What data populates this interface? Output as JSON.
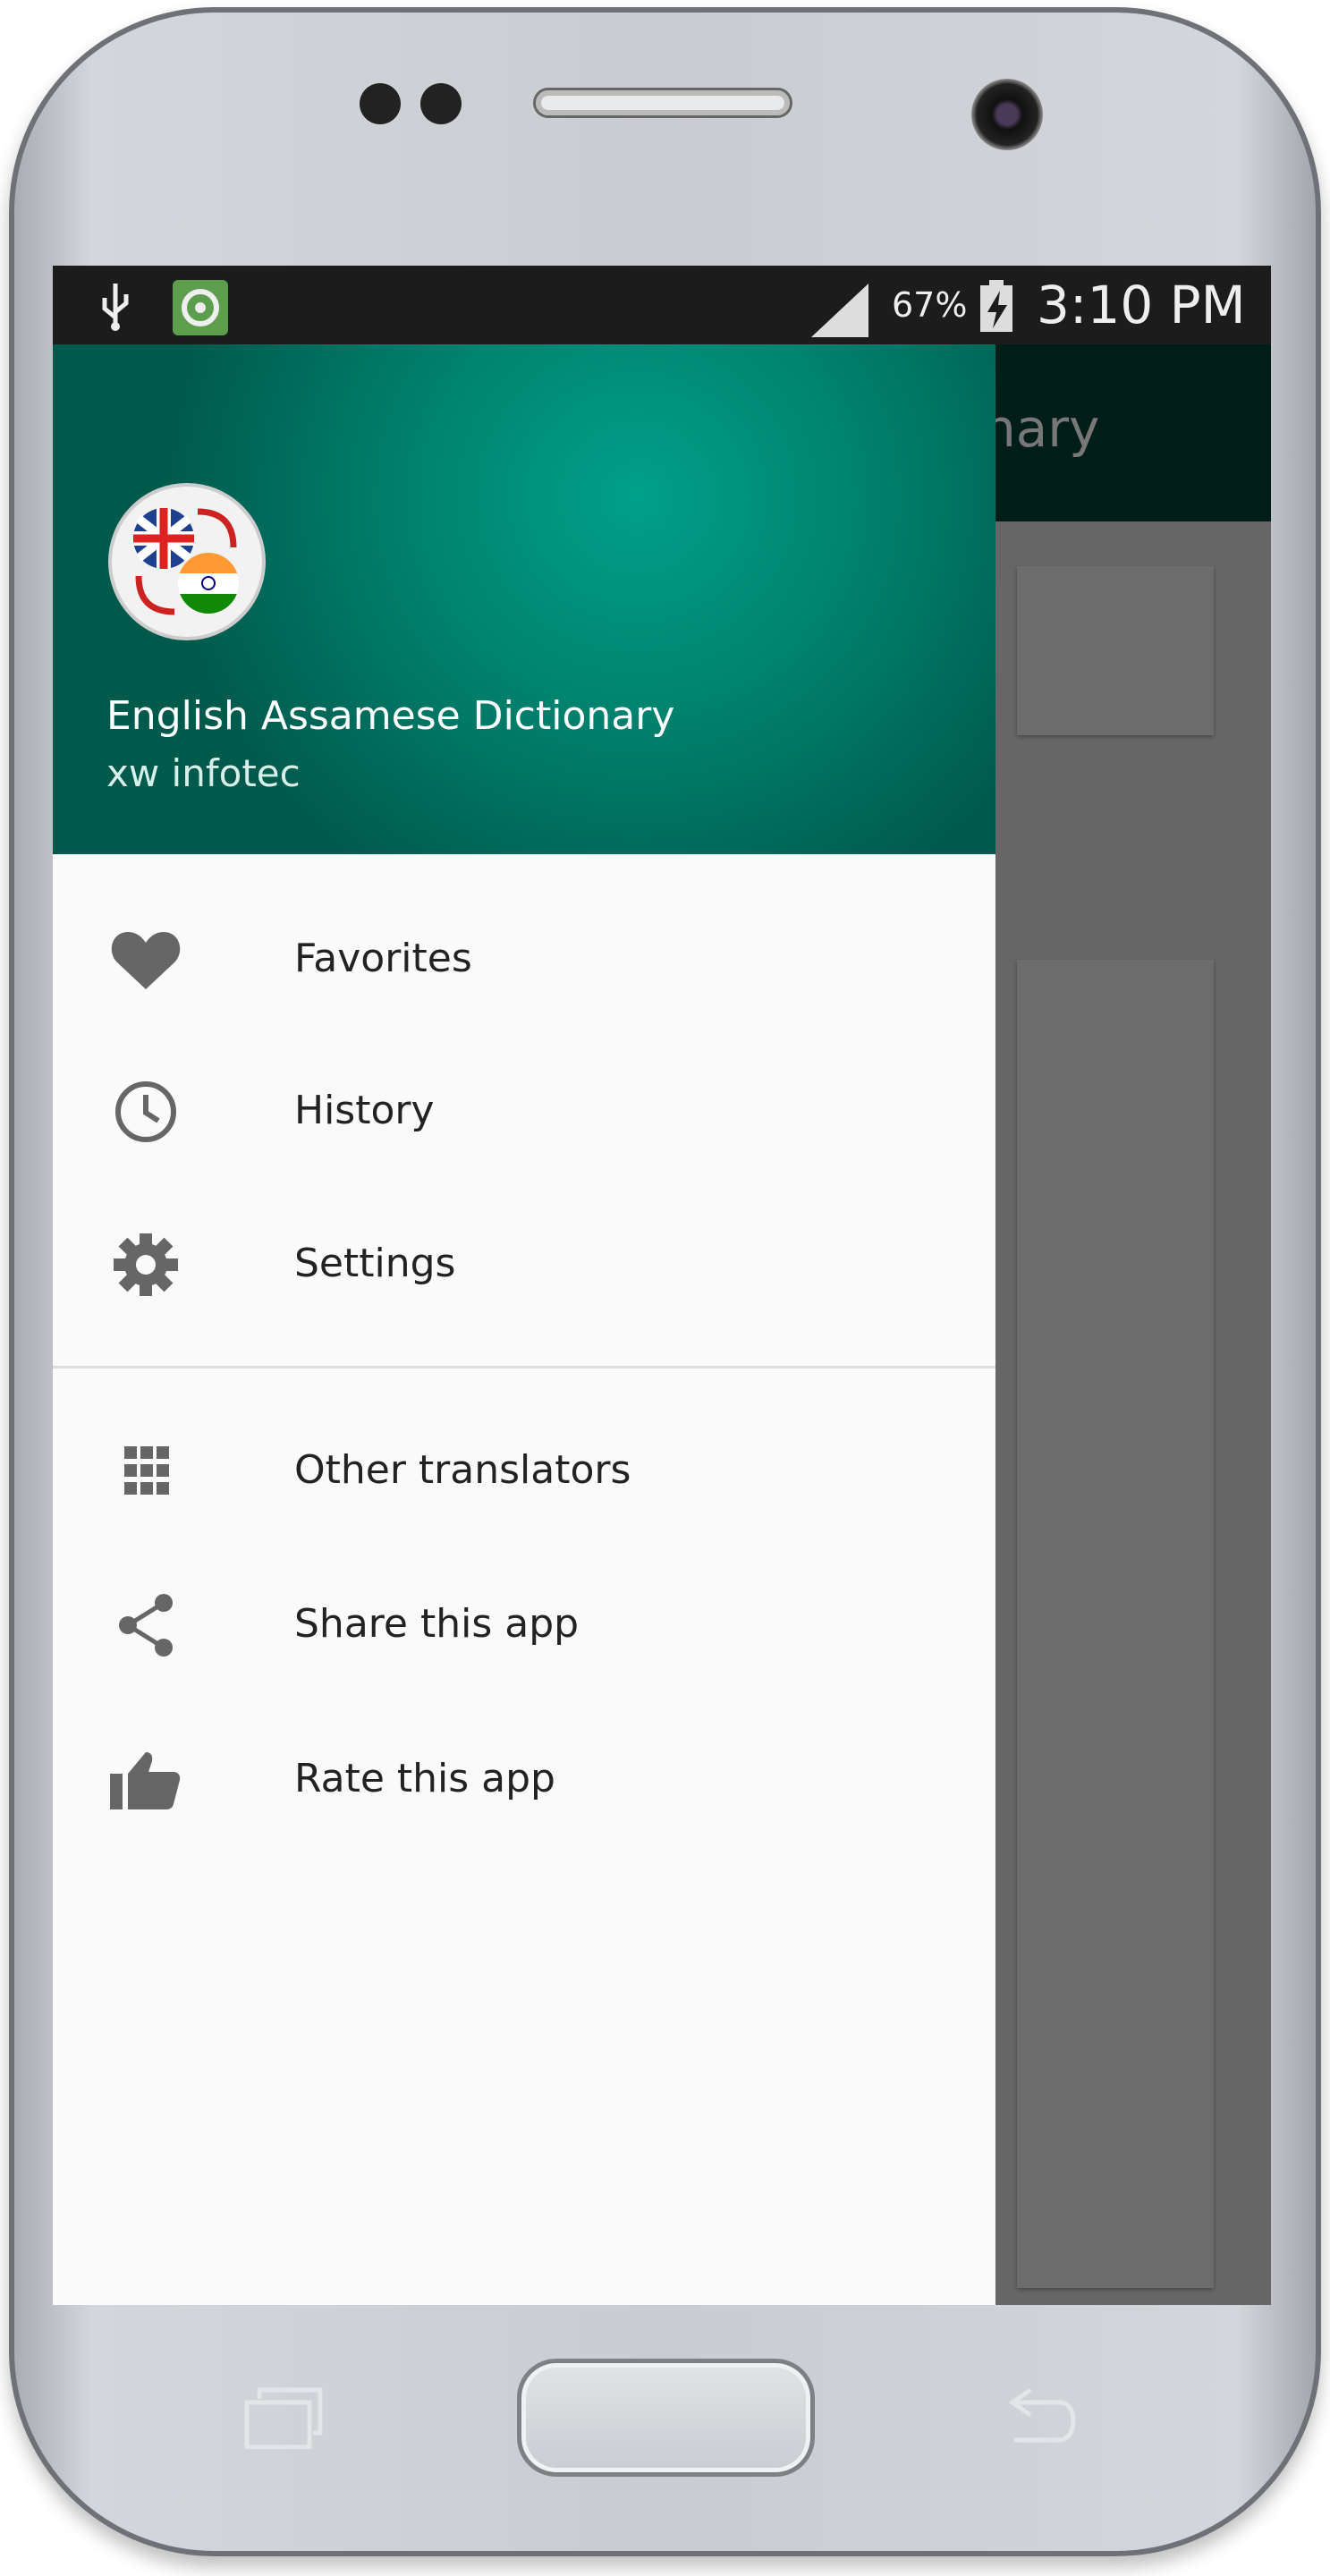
{
  "status_bar": {
    "battery": "67%",
    "time": "3:10 PM",
    "icons": [
      "usb-icon",
      "app-notification-icon",
      "signal-icon",
      "battery-charging-icon"
    ]
  },
  "background_app": {
    "title_fragment": "nary"
  },
  "drawer": {
    "app_name": "English Assamese Dictionary",
    "developer": "xw infotec",
    "accent": "#00897b",
    "items": [
      {
        "label": "Favorites",
        "icon": "heart-icon"
      },
      {
        "label": "History",
        "icon": "clock-icon"
      },
      {
        "label": "Settings",
        "icon": "gear-icon"
      },
      {
        "label": "Other translators",
        "icon": "grid-icon"
      },
      {
        "label": "Share this app",
        "icon": "share-icon"
      },
      {
        "label": "Rate this app",
        "icon": "thumbs-up-icon"
      }
    ]
  }
}
